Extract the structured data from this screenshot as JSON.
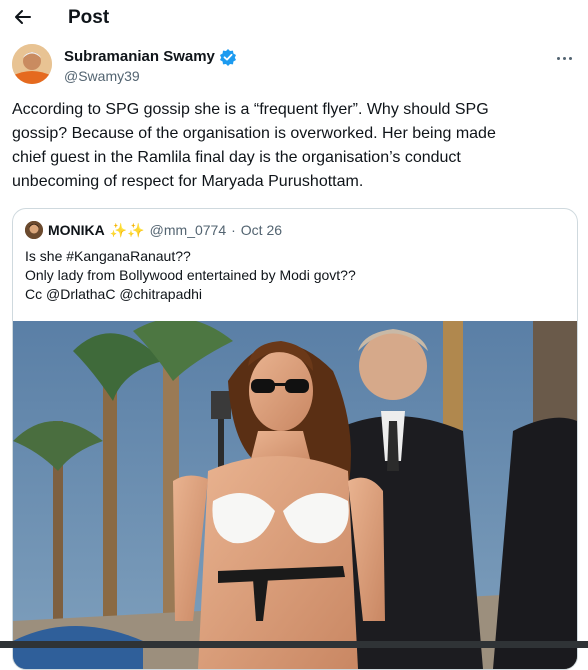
{
  "header": {
    "title": "Post"
  },
  "author": {
    "name": "Subramanian Swamy",
    "handle": "@Swamy39"
  },
  "tweet": {
    "lines": [
      "According to SPG gossip she is a “frequent flyer”. Why should SPG",
      "gossip? Because of the organisation is overworked. Her being made",
      "chief guest in the Ramlila final day is the organisation’s conduct",
      "unbecoming of respect for Maryada Purushottam."
    ]
  },
  "quote": {
    "name": "MONIKA",
    "emoji": "✨✨",
    "handle": "@mm_0774",
    "separator": "·",
    "date": "Oct 26",
    "lines": [
      "Is she #KanganaRanaut??",
      "Only lady from Bollywood entertained by Modi govt??",
      "Cc @DrlathaC @chitrapadhi"
    ]
  },
  "colors": {
    "verified": "#1d9bf0",
    "secondary_text": "#536471",
    "border": "#cfd9de",
    "sparkles": "#f5c518"
  },
  "icons": [
    "back-arrow-icon",
    "verified-badge-icon",
    "more-options-icon"
  ]
}
